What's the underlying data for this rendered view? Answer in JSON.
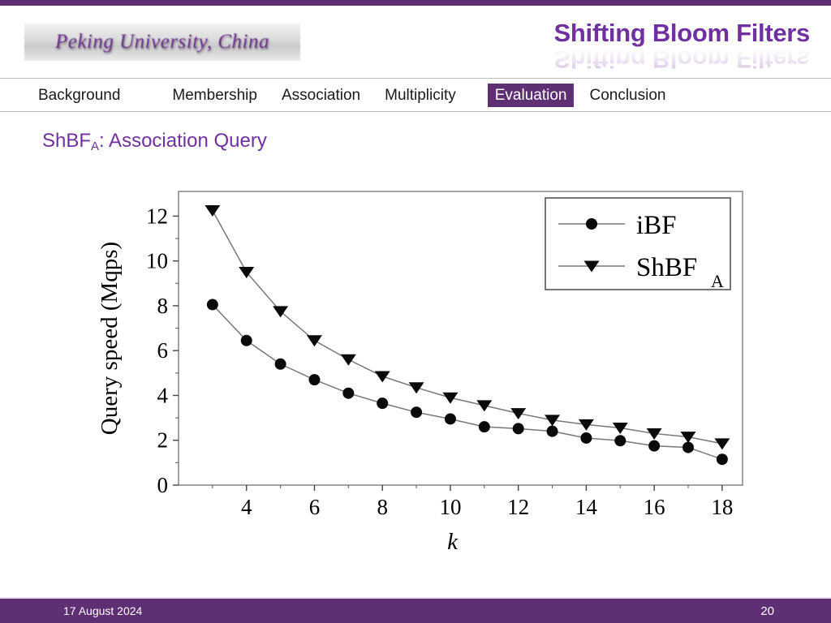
{
  "theme": {
    "accent_purple": "#5f2f73",
    "title_purple": "#7030A0",
    "footer_bg": "#5f2f73",
    "nav_active_bg": "#5f2f73"
  },
  "header": {
    "logo_text": "Peking University, China",
    "deck_title": "Shifting Bloom Filters"
  },
  "nav": {
    "items": [
      {
        "label": "Background",
        "active": false
      },
      {
        "label": "Membership",
        "active": false
      },
      {
        "label": "Association",
        "active": false
      },
      {
        "label": "Multiplicity",
        "active": false
      },
      {
        "label": "Evaluation",
        "active": true
      },
      {
        "label": "Conclusion",
        "active": false
      }
    ]
  },
  "slide": {
    "heading_main": "ShBF",
    "heading_sub": "A",
    "heading_rest": ":   Association Query"
  },
  "footer": {
    "date": "17 August 2024",
    "page_number": "20"
  },
  "chart_data": {
    "type": "line",
    "title": "",
    "xlabel": "k",
    "ylabel": "Query speed  (Mqps)",
    "xlim": [
      2,
      18.6
    ],
    "ylim": [
      0,
      13.1
    ],
    "xticks": [
      4,
      6,
      8,
      10,
      12,
      14,
      16,
      18
    ],
    "xtick_labels": [
      "4",
      "6",
      "8",
      "10",
      "12",
      "14",
      "16",
      "18"
    ],
    "yticks": [
      0,
      2,
      4,
      6,
      8,
      10,
      12
    ],
    "ytick_labels": [
      "0",
      "2",
      "4",
      "6",
      "8",
      "10",
      "12"
    ],
    "yminor": [
      1,
      3,
      5,
      7,
      9,
      11
    ],
    "grid": false,
    "legend_position": "top-right",
    "x": [
      3,
      4,
      5,
      6,
      7,
      8,
      9,
      10,
      11,
      12,
      13,
      14,
      15,
      16,
      17,
      18
    ],
    "series": [
      {
        "name": "iBF",
        "marker": "circle",
        "values": [
          8.05,
          6.45,
          5.4,
          4.7,
          4.1,
          3.65,
          3.25,
          2.95,
          2.6,
          2.52,
          2.4,
          2.1,
          1.98,
          1.75,
          1.68,
          1.15
        ]
      },
      {
        "name": "ShBF",
        "name_sub": "A",
        "marker": "triangle-down",
        "values": [
          12.25,
          9.5,
          7.75,
          6.45,
          5.6,
          4.85,
          4.35,
          3.9,
          3.55,
          3.2,
          2.9,
          2.7,
          2.55,
          2.3,
          2.15,
          1.85
        ]
      }
    ]
  }
}
